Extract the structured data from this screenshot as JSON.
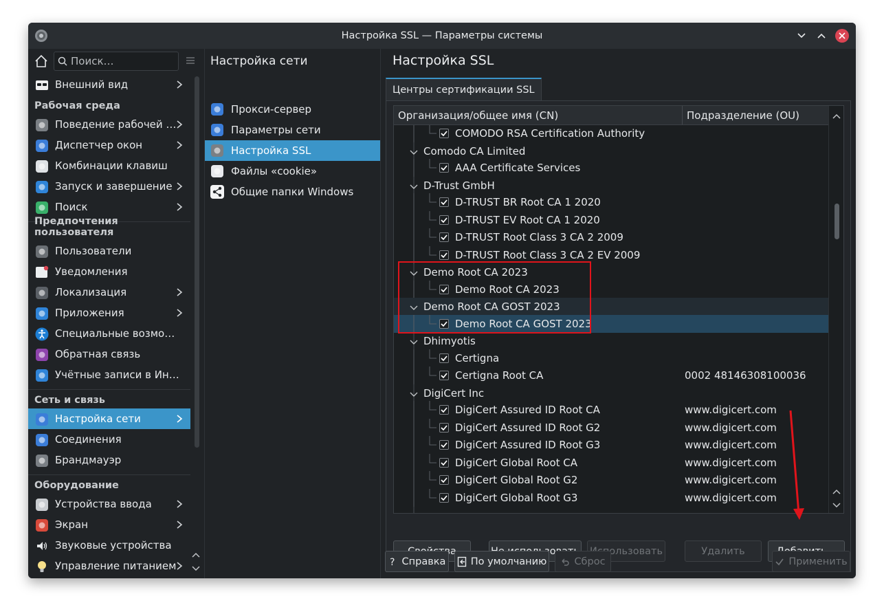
{
  "window": {
    "title": "Настройка SSL — Параметры системы"
  },
  "sidebar": {
    "search_placeholder": "Поиск…",
    "items": [
      {
        "label": "Внешний вид",
        "type": "item",
        "icon": "appearance-icon",
        "chevron": true
      },
      {
        "label": "Рабочая среда",
        "type": "category"
      },
      {
        "label": "Поведение рабочей …",
        "type": "item",
        "icon": "workspace-behavior-icon",
        "chevron": true
      },
      {
        "label": "Диспетчер окон",
        "type": "item",
        "icon": "window-manager-icon",
        "chevron": true
      },
      {
        "label": "Комбинации клавиш",
        "type": "item",
        "icon": "shortcuts-icon",
        "chevron": false
      },
      {
        "label": "Запуск и завершение",
        "type": "item",
        "icon": "startup-icon",
        "chevron": true
      },
      {
        "label": "Поиск",
        "type": "item",
        "icon": "search-settings-icon",
        "chevron": true
      },
      {
        "label": "Предпочтения пользователя",
        "type": "category"
      },
      {
        "label": "Пользователи",
        "type": "item",
        "icon": "users-icon",
        "chevron": false
      },
      {
        "label": "Уведомления",
        "type": "item",
        "icon": "notifications-icon",
        "chevron": false
      },
      {
        "label": "Локализация",
        "type": "item",
        "icon": "localization-icon",
        "chevron": true
      },
      {
        "label": "Приложения",
        "type": "item",
        "icon": "applications-icon",
        "chevron": true
      },
      {
        "label": "Специальные возмо…",
        "type": "item",
        "icon": "accessibility-icon",
        "chevron": false
      },
      {
        "label": "Обратная связь",
        "type": "item",
        "icon": "feedback-icon",
        "chevron": false
      },
      {
        "label": "Учётные записи в Ин…",
        "type": "item",
        "icon": "online-accounts-icon",
        "chevron": false
      },
      {
        "label": "Сеть и связь",
        "type": "category"
      },
      {
        "label": "Настройка сети",
        "type": "item",
        "icon": "network-settings-icon",
        "chevron": true,
        "selected": true
      },
      {
        "label": "Соединения",
        "type": "item",
        "icon": "connections-icon",
        "chevron": false
      },
      {
        "label": "Брандмауэр",
        "type": "item",
        "icon": "firewall-icon",
        "chevron": false
      },
      {
        "label": "Оборудование",
        "type": "category"
      },
      {
        "label": "Устройства ввода",
        "type": "item",
        "icon": "input-devices-icon",
        "chevron": true
      },
      {
        "label": "Экран",
        "type": "item",
        "icon": "display-icon",
        "chevron": true
      },
      {
        "label": "Звуковые устройства",
        "type": "item",
        "icon": "audio-icon",
        "chevron": false
      },
      {
        "label": "Управление питанием",
        "type": "item",
        "icon": "power-icon",
        "chevron": true
      }
    ]
  },
  "middle": {
    "title": "Настройка сети",
    "items": [
      {
        "label": "Прокси-сервер",
        "icon": "proxy-icon"
      },
      {
        "label": "Параметры сети",
        "icon": "network-params-icon"
      },
      {
        "label": "Настройка SSL",
        "icon": "ssl-icon",
        "selected": true
      },
      {
        "label": "Файлы «cookie»",
        "icon": "cookie-icon"
      },
      {
        "label": "Общие папки Windows",
        "icon": "share-icon"
      }
    ]
  },
  "content": {
    "title": "Настройка SSL",
    "tab_label": "Центры сертификации SSL",
    "columns": {
      "cn": "Организация/общее имя (CN)",
      "ou": "Подразделение (OU)"
    },
    "rows": [
      {
        "level": 2,
        "text": "COMODO RSA Certification Authority",
        "ou": "",
        "checked": true
      },
      {
        "level": 1,
        "text": "Comodo CA Limited",
        "ou": ""
      },
      {
        "level": 2,
        "text": "AAA Certificate Services",
        "ou": "",
        "checked": true
      },
      {
        "level": 1,
        "text": "D-Trust GmbH",
        "ou": ""
      },
      {
        "level": 2,
        "text": "D-TRUST BR Root CA 1 2020",
        "ou": "",
        "checked": true
      },
      {
        "level": 2,
        "text": "D-TRUST EV Root CA 1 2020",
        "ou": "",
        "checked": true
      },
      {
        "level": 2,
        "text": "D-TRUST Root Class 3 CA 2 2009",
        "ou": "",
        "checked": true
      },
      {
        "level": 2,
        "text": "D-TRUST Root Class 3 CA 2 EV 2009",
        "ou": "",
        "checked": true
      },
      {
        "level": 1,
        "text": "Demo Root CA 2023",
        "ou": ""
      },
      {
        "level": 2,
        "text": "Demo Root CA 2023",
        "ou": "",
        "checked": true
      },
      {
        "level": 1,
        "text": "Demo Root CA GOST 2023",
        "ou": "",
        "highlight": "group"
      },
      {
        "level": 2,
        "text": "Demo Root CA GOST 2023",
        "ou": "",
        "checked": true,
        "highlight": "selected"
      },
      {
        "level": 1,
        "text": "Dhimyotis",
        "ou": ""
      },
      {
        "level": 2,
        "text": "Certigna",
        "ou": "",
        "checked": true
      },
      {
        "level": 2,
        "text": "Certigna Root CA",
        "ou": "0002 48146308100036",
        "checked": true
      },
      {
        "level": 1,
        "text": "DigiCert Inc",
        "ou": ""
      },
      {
        "level": 2,
        "text": "DigiCert Assured ID Root CA",
        "ou": "www.digicert.com",
        "checked": true
      },
      {
        "level": 2,
        "text": "DigiCert Assured ID Root G2",
        "ou": "www.digicert.com",
        "checked": true
      },
      {
        "level": 2,
        "text": "DigiCert Assured ID Root G3",
        "ou": "www.digicert.com",
        "checked": true
      },
      {
        "level": 2,
        "text": "DigiCert Global Root CA",
        "ou": "www.digicert.com",
        "checked": true
      },
      {
        "level": 2,
        "text": "DigiCert Global Root G2",
        "ou": "www.digicert.com",
        "checked": true
      },
      {
        "level": 2,
        "text": "DigiCert Global Root G3",
        "ou": "www.digicert.com",
        "checked": true
      }
    ],
    "buttons": {
      "properties": "Свойства",
      "disable": "Не использовать",
      "enable": "Использовать",
      "delete": "Удалить",
      "add": "Добавить..."
    }
  },
  "footer": {
    "help": "Справка",
    "defaults": "По умолчанию",
    "reset": "Сброс",
    "apply": "Применить"
  },
  "colors": {
    "accent": "#3b95c9",
    "selected_row": "#25475e",
    "annotation": "#e0141b",
    "close_button": "#da4453"
  }
}
